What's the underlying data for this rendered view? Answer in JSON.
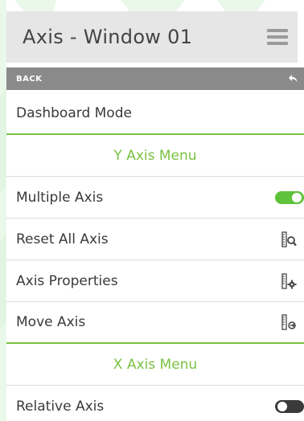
{
  "header": {
    "title": "Axis - Window 01",
    "menu_icon": "hamburger-icon"
  },
  "backbar": {
    "label": "BACK",
    "icon": "undo-arrow-icon"
  },
  "rows": {
    "dashboard": {
      "label": "Dashboard Mode"
    },
    "y_section": {
      "label": "Y Axis Menu"
    },
    "multiple_axis": {
      "label": "Multiple Axis",
      "toggle": "on"
    },
    "reset_all_axis": {
      "label": "Reset All Axis",
      "icon": "ruler-zoom-icon"
    },
    "axis_properties": {
      "label": "Axis Properties",
      "icon": "ruler-gear-icon"
    },
    "move_axis": {
      "label": "Move Axis",
      "icon": "ruler-move-icon"
    },
    "x_section": {
      "label": "X Axis Menu"
    },
    "relative_axis": {
      "label": "Relative Axis",
      "toggle": "off"
    }
  },
  "colors": {
    "accent": "#7ac142",
    "toggle_on": "#5ec23a",
    "toggle_off": "#3a3a3a",
    "header_bg": "#e6e6e6",
    "backbar_bg": "#8a8a8a"
  }
}
